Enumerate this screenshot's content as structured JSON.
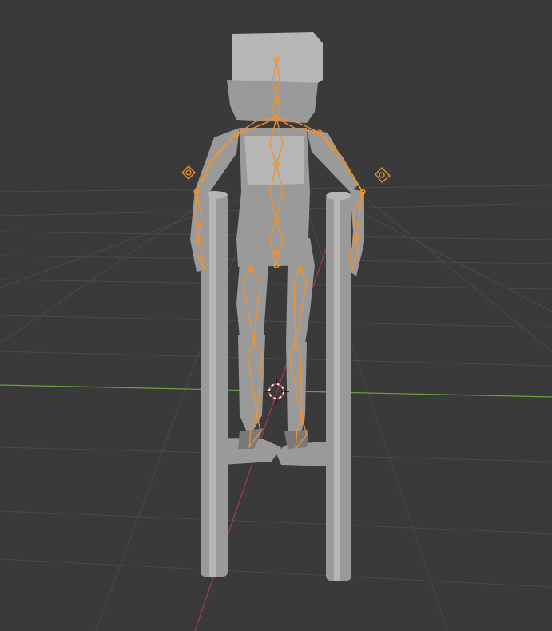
{
  "viewport": {
    "name": "3D Viewport",
    "background_color": "#3a3a3a",
    "grid_color": "#4a4a4a",
    "x_axis_color": "#b0384a",
    "y_axis_color": "#6aa23a",
    "mesh_color": "#9a9a9a",
    "mesh_shadow_color": "#7a7a7a",
    "mesh_highlight_color": "#b6b6b6",
    "armature_color": "#f0922e"
  },
  "scene": {
    "objects": [
      {
        "name": "character-mesh",
        "type": "mesh"
      },
      {
        "name": "left-stilt-pole",
        "type": "mesh"
      },
      {
        "name": "right-stilt-pole",
        "type": "mesh"
      },
      {
        "name": "armature",
        "type": "armature",
        "selected": true
      },
      {
        "name": "3d-cursor",
        "type": "cursor"
      }
    ]
  }
}
